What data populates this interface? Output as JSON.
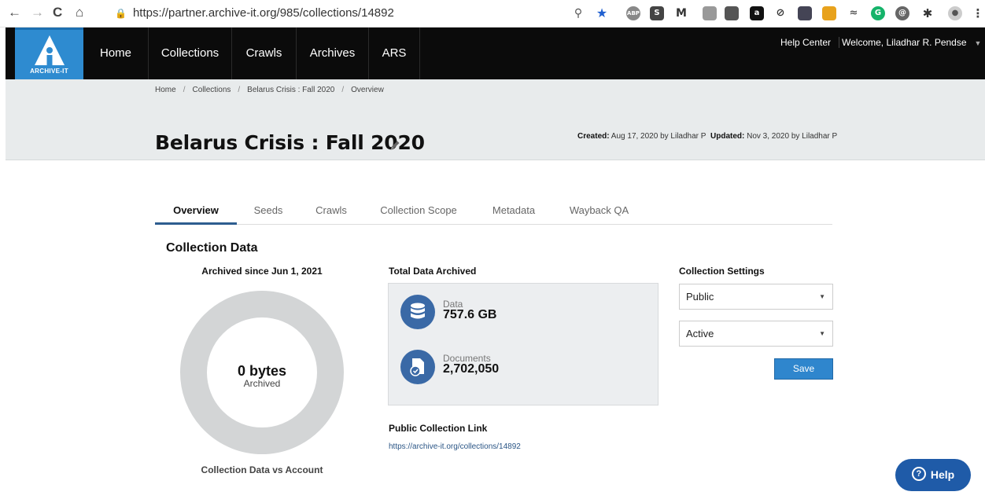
{
  "browser": {
    "url": "https://partner.archive-it.org/985/collections/14892",
    "back": "←",
    "forward": "→",
    "reload": "C",
    "home": "⌂"
  },
  "nav": {
    "logo_text": "ARCHIVE-IT",
    "items": [
      "Home",
      "Collections",
      "Crawls",
      "Archives",
      "ARS"
    ],
    "help_center": "Help Center",
    "welcome": "Welcome, Liladhar R. Pendse"
  },
  "breadcrumb": [
    "Home",
    "Collections",
    "Belarus Crisis : Fall 2020",
    "Overview"
  ],
  "header": {
    "title": "Belarus Crisis : Fall 2020",
    "created_label": "Created:",
    "created_text": " Aug 17, 2020 by Liladhar P",
    "updated_label": "Updated:",
    "updated_text": " Nov 3, 2020 by Liladhar P"
  },
  "tabs": [
    "Overview",
    "Seeds",
    "Crawls",
    "Collection Scope",
    "Metadata",
    "Wayback QA"
  ],
  "collection_data": {
    "heading": "Collection Data",
    "archived_since": "Archived since Jun 1, 2021",
    "donut_value": "0 bytes",
    "donut_label": "Archived",
    "caption": "Collection Data vs Account"
  },
  "total": {
    "heading": "Total Data Archived",
    "data_label": "Data",
    "data_value": "757.6 GB",
    "docs_label": "Documents",
    "docs_value": "2,702,050"
  },
  "public_link": {
    "heading": "Public Collection Link",
    "url": "https://archive-it.org/collections/14892"
  },
  "settings": {
    "heading": "Collection Settings",
    "visibility": "Public",
    "status": "Active",
    "save_label": "Save"
  },
  "help_button": "Help",
  "colors": {
    "nav_bg": "#0b0b0b",
    "logo_bg": "#2e8bd0",
    "accent": "#3a69a6",
    "save_bg": "#2f86cd",
    "help_bg": "#1f5ba8"
  }
}
